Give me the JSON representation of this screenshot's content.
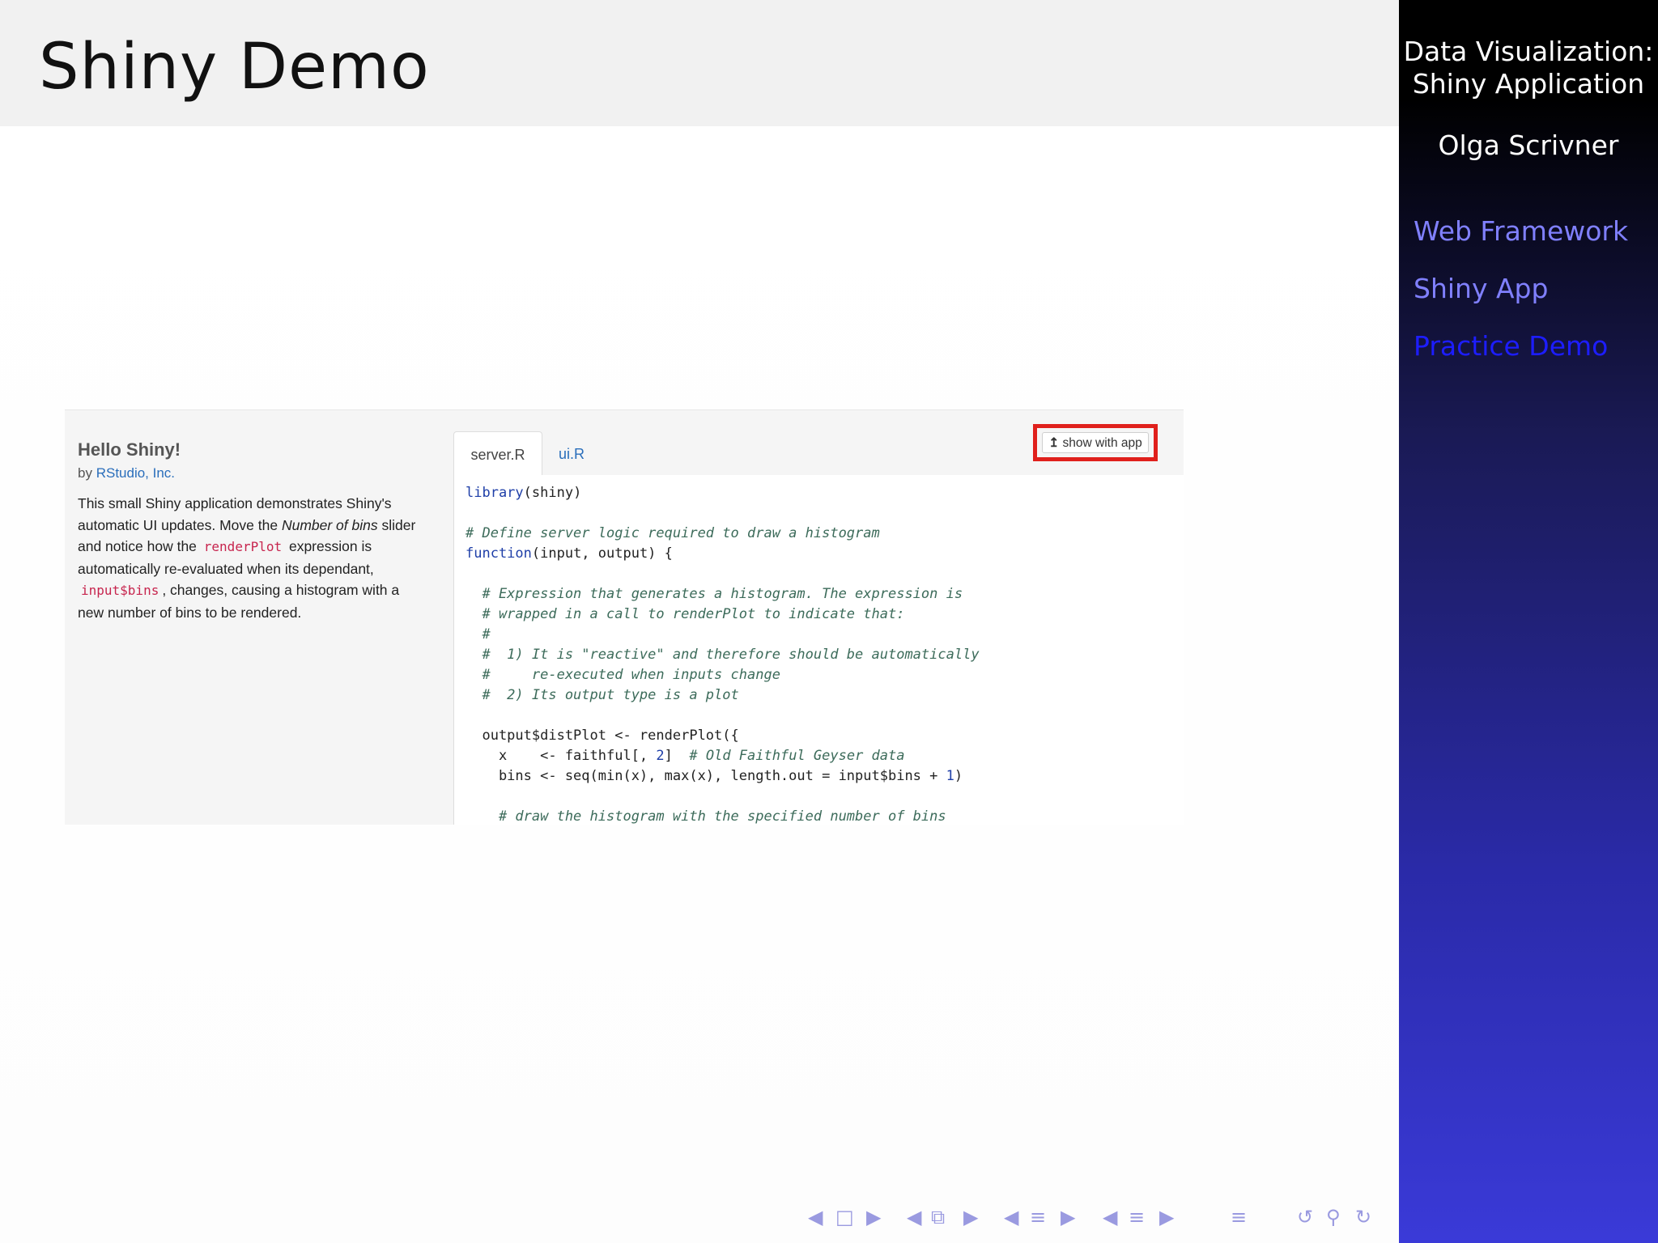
{
  "slide": {
    "title": "Shiny Demo"
  },
  "sidebar": {
    "title_line1": "Data Visualization:",
    "title_line2": "Shiny Application",
    "author": "Olga Scrivner",
    "items": [
      {
        "label": "Web Framework",
        "active": false
      },
      {
        "label": "Shiny App",
        "active": false
      },
      {
        "label": "Practice Demo",
        "active": true
      }
    ]
  },
  "embedded": {
    "hello_title": "Hello Shiny!",
    "by_prefix": "by",
    "by_link": "RStudio, Inc.",
    "desc_1": "This small Shiny application demonstrates Shiny's automatic UI updates. Move the ",
    "desc_em": "Number of bins",
    "desc_2": " slider and notice how the ",
    "desc_code1": "renderPlot",
    "desc_3": " expression is automatically re-evaluated when its dependant, ",
    "desc_code2": "input$bins",
    "desc_4": ", changes, causing a histogram with a new number of bins to be rendered.",
    "tabs": [
      "server.R",
      "ui.R"
    ],
    "show_with_app": "show with app",
    "code_lines": {
      "l1_kw": "library",
      "l1_rest": "(shiny)",
      "l2": "# Define server logic required to draw a histogram",
      "l3_kw": "function",
      "l3_rest": "(input, output) {",
      "l4": "  # Expression that generates a histogram. The expression is",
      "l5": "  # wrapped in a call to renderPlot to indicate that:",
      "l6": "  #",
      "l7": "  #  1) It is \"reactive\" and therefore should be automatically",
      "l8": "  #     re-executed when inputs change",
      "l9": "  #  2) Its output type is a plot",
      "l10": "  output$distPlot <- renderPlot({",
      "l11_a": "    x    <- faithful[, ",
      "l11_num": "2",
      "l11_b": "]  ",
      "l11_cm": "# Old Faithful Geyser data",
      "l12_a": "    bins <- seq(min(x), max(x), length.out = input$bins + ",
      "l12_num": "1",
      "l12_b": ")",
      "l13": "    # draw the histogram with the specified number of bins"
    }
  },
  "nav": {
    "icons": [
      "nav-prev-frame-icon",
      "frame-icon",
      "nav-next-frame-icon",
      "nav-prev-subsection-icon",
      "subsection-icon",
      "nav-next-subsection-icon",
      "nav-prev-section-icon",
      "section-icon",
      "nav-next-section-icon",
      "nav-prev-doc-icon",
      "doc-icon",
      "nav-next-doc-icon",
      "toc-icon",
      "back-icon",
      "search-icon",
      "forward-icon"
    ]
  },
  "colors": {
    "sidebar_link": "#8080ff",
    "sidebar_active": "#1d1dff",
    "highlight_border": "#e0201c",
    "link_blue": "#2a6ebb"
  }
}
